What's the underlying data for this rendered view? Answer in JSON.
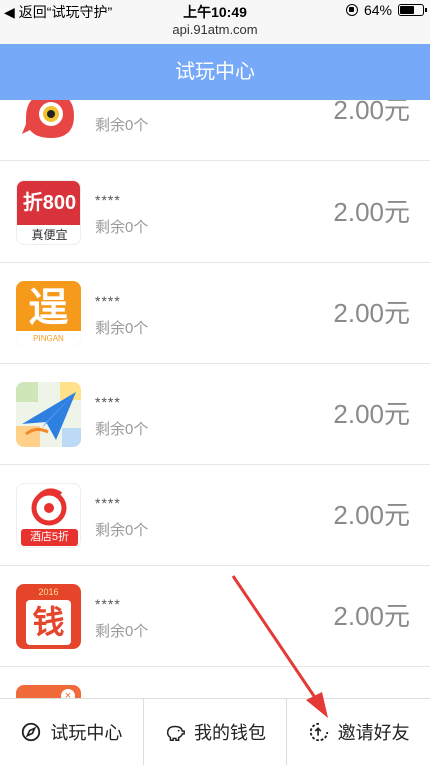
{
  "status": {
    "back_label": "返回“试玩守护”",
    "time": "上午10:49",
    "url": "api.91atm.com",
    "battery": "64%"
  },
  "header": {
    "title": "试玩中心"
  },
  "items": [
    {
      "name": "****",
      "remain": "剩余0个",
      "price": "2.00元",
      "icon": "red-monster-app-icon"
    },
    {
      "name": "****",
      "remain": "剩余0个",
      "price": "2.00元",
      "icon": "zhe800-app-icon",
      "icon_text": "折800",
      "icon_sub": "真便宜"
    },
    {
      "name": "****",
      "remain": "剩余0个",
      "price": "2.00元",
      "icon": "pingan-app-icon",
      "icon_text": "逞",
      "icon_sub": "PINGAN"
    },
    {
      "name": "****",
      "remain": "剩余0个",
      "price": "2.00元",
      "icon": "paper-plane-map-app-icon"
    },
    {
      "name": "****",
      "remain": "剩余0个",
      "price": "2.00元",
      "icon": "hotel-app-icon",
      "icon_sub": "酒店5折"
    },
    {
      "name": "****",
      "remain": "剩余0个",
      "price": "2.00元",
      "icon": "money-app-icon",
      "icon_text": "钱",
      "icon_sub": "2016"
    }
  ],
  "tabs": [
    {
      "label": "试玩中心",
      "icon": "compass-icon"
    },
    {
      "label": "我的钱包",
      "icon": "piggy-bank-icon"
    },
    {
      "label": "邀请好友",
      "icon": "share-icon"
    }
  ],
  "colors": {
    "header_bg": "#76a9f8",
    "price": "#8a8a8a",
    "annotation_arrow": "#e53935"
  }
}
